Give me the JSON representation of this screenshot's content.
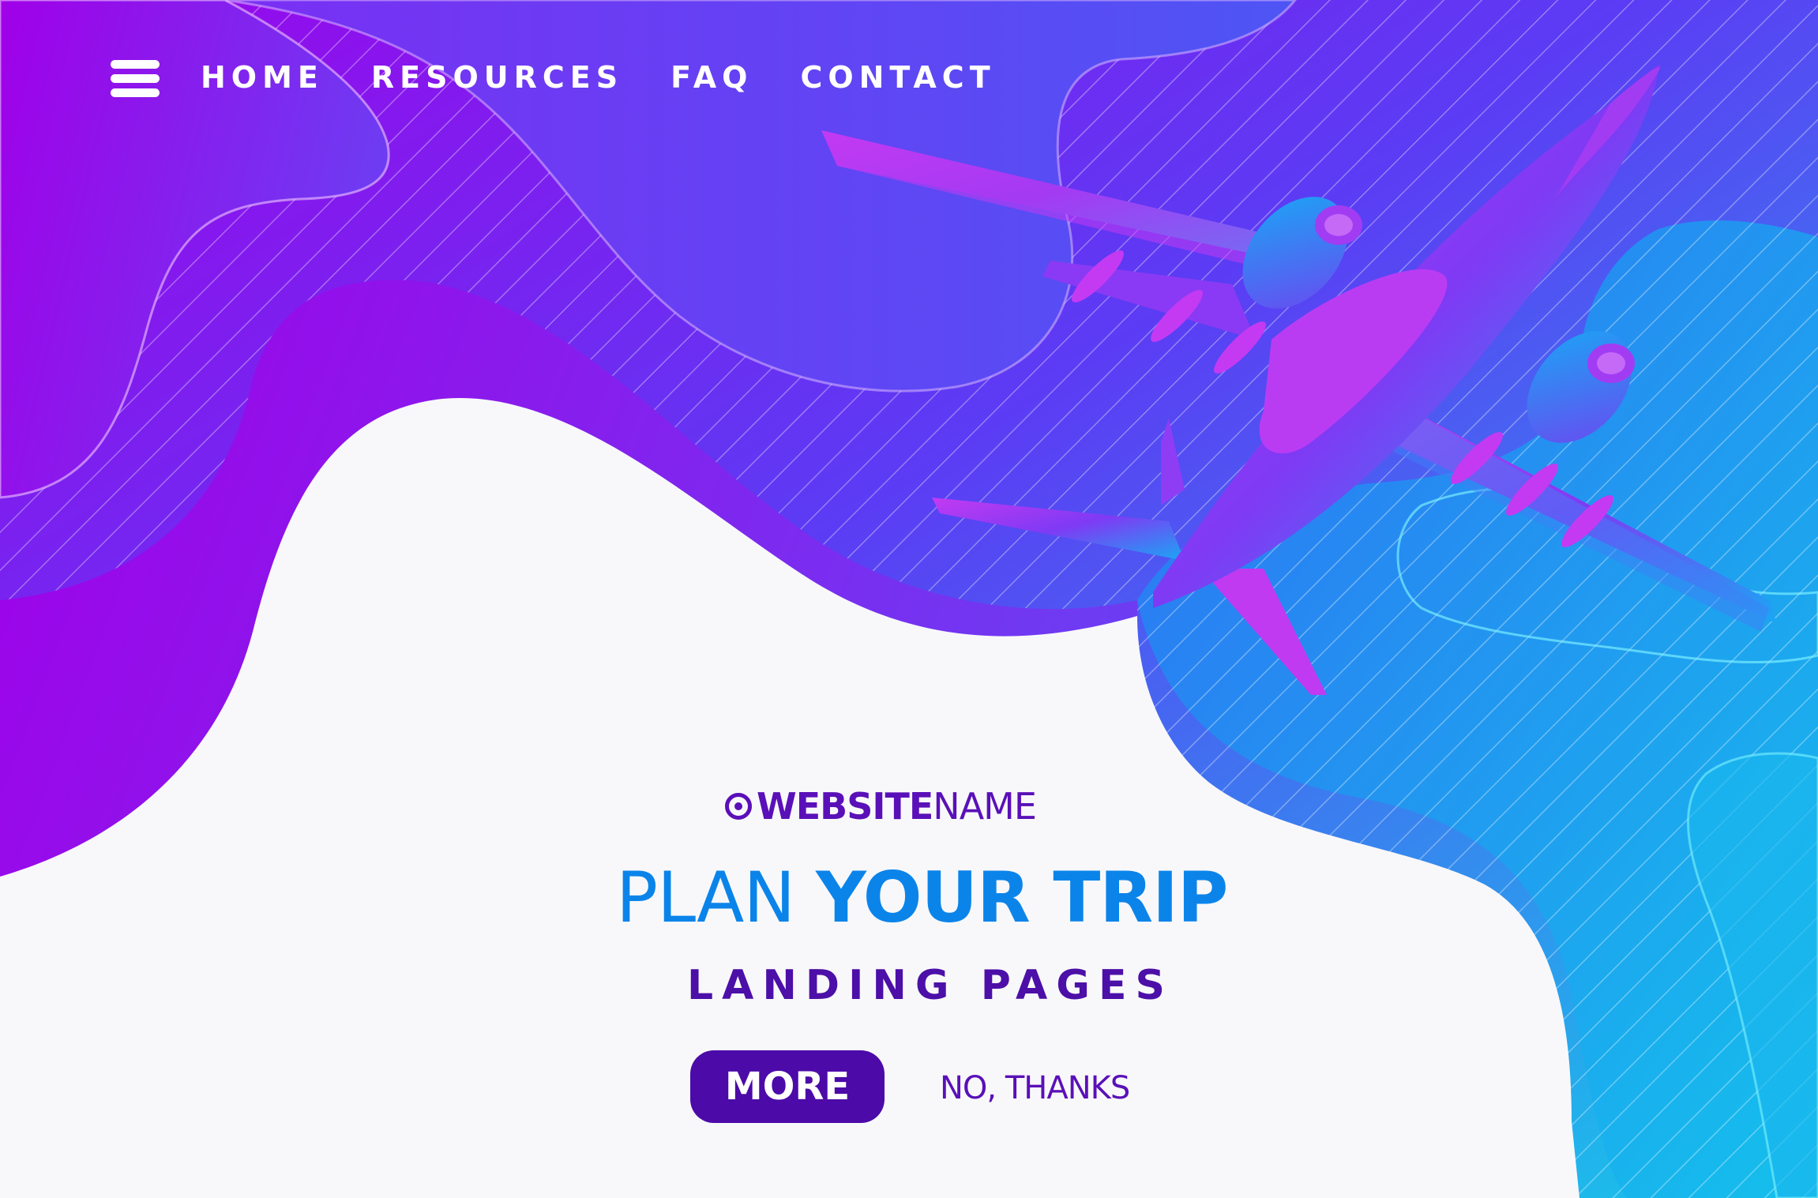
{
  "nav": {
    "items": [
      {
        "label": "HOME"
      },
      {
        "label": "RESOURCES"
      },
      {
        "label": "FAQ"
      },
      {
        "label": "CONTACT"
      }
    ],
    "menu_icon": "hamburger-menu-icon"
  },
  "brand": {
    "icon": "target-icon",
    "bold": "WEBSITE",
    "light": "NAME"
  },
  "hero": {
    "headline_light": "PLAN ",
    "headline_bold": "YOUR TRIP",
    "subheadline": "LANDING PAGES",
    "primary_button": "MORE",
    "secondary_button": "NO, THANKS"
  },
  "colors": {
    "purple": "#9a00e8",
    "blue": "#2f80f2",
    "cyan": "#18c8ea",
    "dark_purple": "#4c0aa8",
    "headline_blue": "#0b84ea",
    "background": "#f8f8fa"
  }
}
